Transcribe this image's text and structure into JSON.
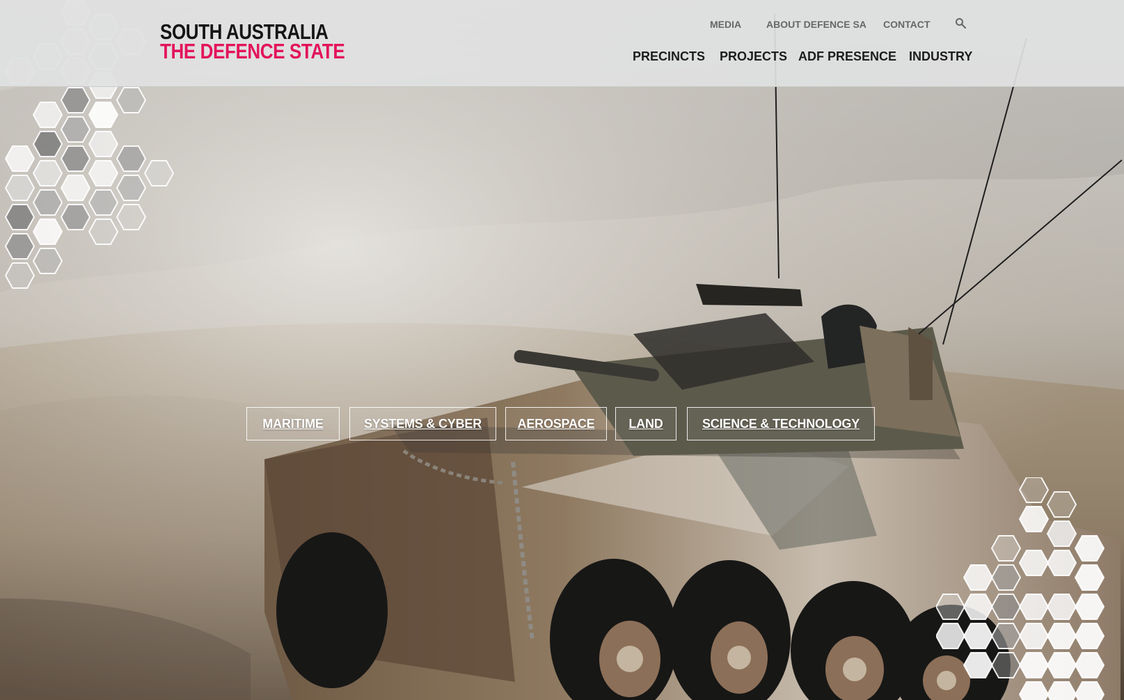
{
  "brand": {
    "line1": "SOUTH AUSTRALIA",
    "line2": "THE DEFENCE STATE",
    "accent_color": "#e3135c",
    "text_color": "#151515"
  },
  "utility_nav": {
    "items": [
      "MEDIA",
      "ABOUT DEFENCE SA",
      "CONTACT"
    ],
    "search_icon": "search-icon"
  },
  "main_nav": {
    "items": [
      "PRECINCTS",
      "PROJECTS",
      "ADF PRESENCE",
      "INDUSTRY"
    ]
  },
  "categories": {
    "items": [
      "MARITIME",
      "SYSTEMS & CYBER",
      "AEROSPACE",
      "LAND",
      "SCIENCE & TECHNOLOGY"
    ]
  }
}
